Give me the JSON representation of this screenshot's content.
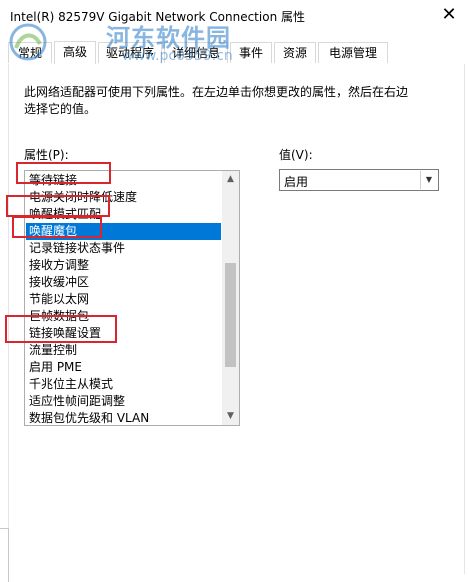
{
  "window": {
    "title": "Intel(R) 82579V Gigabit Network Connection 属性",
    "close_glyph": "✕"
  },
  "watermark": {
    "brand": "河东软件园",
    "url": "www.pc0359.cn"
  },
  "tabs": [
    {
      "label": "常规",
      "active": false
    },
    {
      "label": "高级",
      "active": true
    },
    {
      "label": "驱动程序",
      "active": false
    },
    {
      "label": "详细信息",
      "active": false
    },
    {
      "label": "事件",
      "active": false
    },
    {
      "label": "资源",
      "active": false
    },
    {
      "label": "电源管理",
      "active": false
    }
  ],
  "description": "此网络适配器可使用下列属性。在左边单击你想更改的属性，然后在右边选择它的值。",
  "property_label": "属性(P):",
  "value_label": "值(V):",
  "properties": [
    {
      "label": "等待链接",
      "selected": false
    },
    {
      "label": "电源关闭时降低速度",
      "selected": false
    },
    {
      "label": "唤醒模式匹配",
      "selected": false
    },
    {
      "label": "唤醒魔包",
      "selected": true
    },
    {
      "label": "记录链接状态事件",
      "selected": false
    },
    {
      "label": "接收方调整",
      "selected": false
    },
    {
      "label": "接收缓冲区",
      "selected": false
    },
    {
      "label": "节能以太网",
      "selected": false
    },
    {
      "label": "巨帧数据包",
      "selected": false
    },
    {
      "label": "链接唤醒设置",
      "selected": false
    },
    {
      "label": "流量控制",
      "selected": false
    },
    {
      "label": "启用 PME",
      "selected": false
    },
    {
      "label": "千兆位主从模式",
      "selected": false
    },
    {
      "label": "适应性帧间距调整",
      "selected": false
    },
    {
      "label": "数据包优先级和 VLAN",
      "selected": false
    }
  ],
  "value_select": {
    "selected": "启用"
  },
  "icons": {
    "scroll_up": "▲",
    "scroll_down": "▼",
    "dropdown": "▼"
  },
  "colors": {
    "selection": "#0078d7",
    "highlight_box": "#d9262e",
    "watermark": "#2a7cc7"
  }
}
